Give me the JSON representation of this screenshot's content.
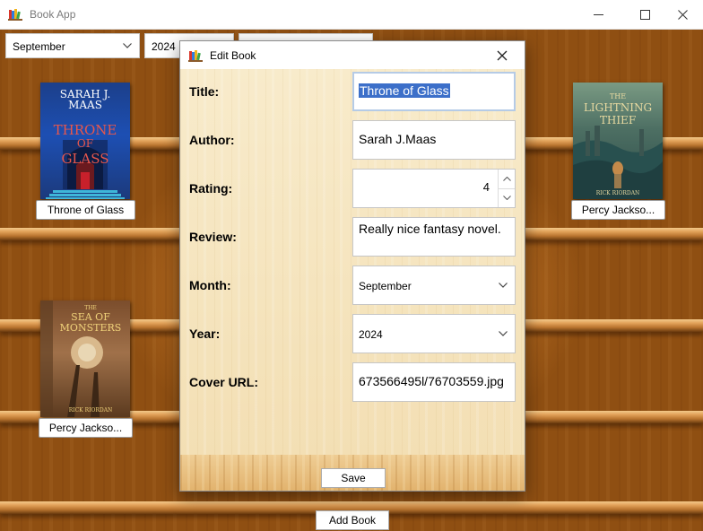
{
  "app": {
    "title": "Book App"
  },
  "filters": {
    "month": "September",
    "year": "2024"
  },
  "shelf": {
    "books": [
      {
        "title": "Throne of Glass",
        "cover_lines": [
          "SARAH J.",
          "MAAS",
          "THRONE",
          "OF",
          "GLASS"
        ]
      },
      {
        "title": "Percy Jackso...",
        "cover_lines": [
          "THE",
          "LIGHTNING",
          "THIEF",
          "RICK RIORDAN"
        ]
      },
      {
        "title": "Percy Jackso...",
        "cover_lines": [
          "THE",
          "SEA OF",
          "MONSTERS",
          "RICK RIORDAN"
        ]
      }
    ],
    "add_button": "Add Book"
  },
  "dialog": {
    "title": "Edit Book",
    "labels": {
      "title": "Title:",
      "author": "Author:",
      "rating": "Rating:",
      "review": "Review:",
      "month": "Month:",
      "year": "Year:",
      "cover": "Cover URL:"
    },
    "values": {
      "title": "Throne of Glass",
      "author": "Sarah J.Maas",
      "rating": "4",
      "review": "Really nice fantasy novel.",
      "month": "September",
      "year": "2024",
      "cover": "673566495l/76703559.jpg"
    },
    "save_button": "Save"
  },
  "colors": {
    "accent": "#3c6fc9",
    "shelf_wood": "#b86d22",
    "dialog_bg": "#f7e8c6"
  },
  "icons": [
    "books-icon",
    "minimize-icon",
    "maximize-icon",
    "close-icon",
    "chevron-down-icon",
    "spin-up-icon",
    "spin-down-icon"
  ]
}
